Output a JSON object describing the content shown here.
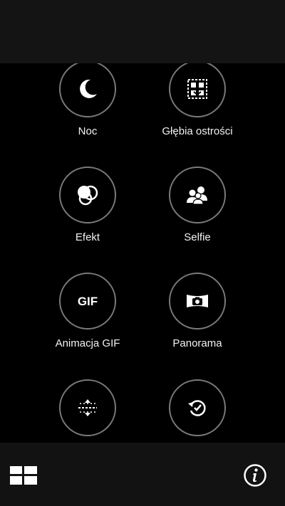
{
  "modes": [
    {
      "label": "Noc",
      "icon": "moon-icon"
    },
    {
      "label": "Głębia ostrości",
      "icon": "depth-of-field-icon"
    },
    {
      "label": "Efekt",
      "icon": "effect-circles-icon"
    },
    {
      "label": "Selfie",
      "icon": "group-selfie-icon"
    },
    {
      "label": "Animacja GIF",
      "icon": "gif-icon",
      "icon_text": "GIF"
    },
    {
      "label": "Panorama",
      "icon": "panorama-icon"
    },
    {
      "label": "",
      "icon": "time-lapse-icon"
    },
    {
      "label": "",
      "icon": "time-rewind-icon"
    }
  ],
  "bottom_bar": {
    "grid_icon": "grid-view-icon",
    "info_icon": "info-icon"
  },
  "colors": {
    "background": "#000000",
    "top_bar": "#141414",
    "bottom_bar": "#121212",
    "circle_border": "#7a7a7a",
    "text": "#f2f2f2"
  }
}
